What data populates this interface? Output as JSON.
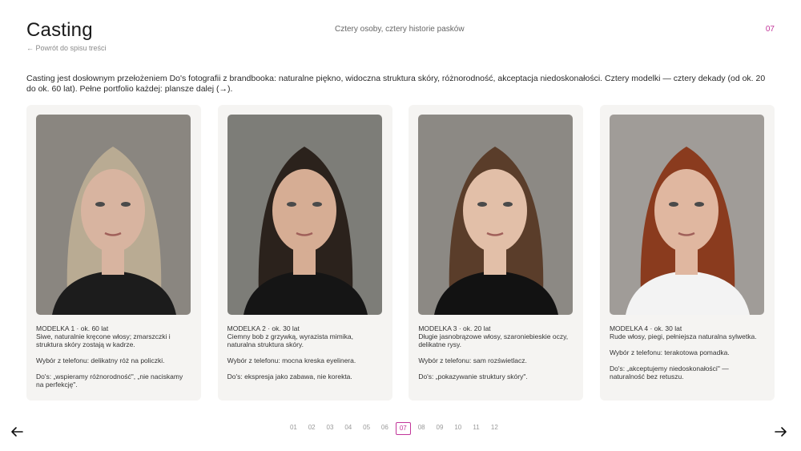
{
  "header": {
    "title": "Casting",
    "back_link": "← Powrót do spisu treści",
    "subtitle": "Cztery osoby, cztery historie pasków",
    "page_number": "07"
  },
  "intro": "Casting jest dosłownym przełożeniem Do's fotografii z brandbooka: naturalne piękno, widoczna struktura skóry, różnorodność, akceptacja niedoskonałości. Cztery modelki — cztery dekady (od ok. 20 do ok. 60 lat). Pełne portfolio każdej: plansze dalej (→).",
  "models": [
    {
      "heading": "MODELKA 1 · ok. 60 lat",
      "description": "Siwe, naturalnie kręcone włosy; zmarszczki i struktura skóry zostają w kadrze.",
      "phone_choice": "Wybór z telefonu: delikatny róż na policzki.",
      "dos": "Do's: „wspieramy różnorodność\", „nie naciskamy na perfekcję\".",
      "palette": {
        "bg": "#8a8680",
        "hair": "#b9ab93",
        "skin": "#d8b4a0",
        "top": "#1c1c1c"
      }
    },
    {
      "heading": "MODELKA 2 · ok. 30 lat",
      "description": "Ciemny bob z grzywką, wyrazista mimika, naturalna struktura skóry.",
      "phone_choice": "Wybór z telefonu: mocna kreska eyelinera.",
      "dos": "Do's: ekspresja jako zabawa, nie korekta.",
      "palette": {
        "bg": "#7d7d78",
        "hair": "#2b221c",
        "skin": "#d6ad94",
        "top": "#151515"
      }
    },
    {
      "heading": "MODELKA 3 · ok. 20 lat",
      "description": "Długie jasnobrązowe włosy, szaroniebieskie oczy, delikatne rysy.",
      "phone_choice": "Wybór z telefonu: sam rozświetlacz.",
      "dos": "Do's: „pokazywanie struktury skóry\".",
      "palette": {
        "bg": "#8c8984",
        "hair": "#5a3d2a",
        "skin": "#e2bfa8",
        "top": "#121212"
      }
    },
    {
      "heading": "MODELKA 4 · ok. 30 lat",
      "description": "Rude włosy, piegi, pełniejsza naturalna sylwetka.",
      "phone_choice": "Wybór z telefonu: terakotowa pomadka.",
      "dos": "Do's: „akceptujemy niedoskonałości\" — naturalność bez retuszu.",
      "palette": {
        "bg": "#a09c98",
        "hair": "#8a3b1e",
        "skin": "#e0b7a0",
        "top": "#f3f3f3"
      }
    }
  ],
  "pager": {
    "pages": [
      "01",
      "02",
      "03",
      "04",
      "05",
      "06",
      "07",
      "08",
      "09",
      "10",
      "11",
      "12"
    ],
    "active": "07"
  },
  "icons": {
    "prev": "arrow-left-icon",
    "next": "arrow-right-icon"
  }
}
